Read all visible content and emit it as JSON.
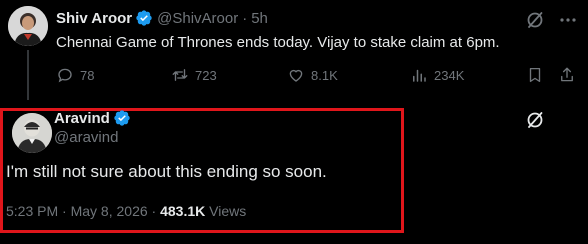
{
  "parent_tweet": {
    "author_name": "Shiv Aroor",
    "handle": "@ShivAroor",
    "separator": "·",
    "time_ago": "5h",
    "text": "Chennai Game of Thrones ends today. Vijay to stake claim at 6pm.",
    "actions": {
      "replies": "78",
      "retweets": "723",
      "likes": "8.1K",
      "views": "234K"
    }
  },
  "reply_tweet": {
    "author_name": "Aravind",
    "handle": "@aravind",
    "text": "I'm still not sure about this ending so soon.",
    "time": "5:23 PM",
    "separator": "·",
    "date": "May 8, 2026",
    "separator2": "·",
    "views_count": "483.1K",
    "views_label": "Views"
  },
  "colors": {
    "background": "#000000",
    "text_primary": "#e7e9ea",
    "text_muted": "#71767b",
    "verified_badge": "#1d9bf0",
    "highlight_border": "#e0161b"
  },
  "icons": {
    "verified": "verified-badge-icon",
    "grok": "grok-icon",
    "more": "more-icon",
    "reply": "reply-icon",
    "retweet": "retweet-icon",
    "like": "heart-icon",
    "views": "views-chart-icon",
    "bookmark": "bookmark-icon",
    "share": "share-icon"
  }
}
